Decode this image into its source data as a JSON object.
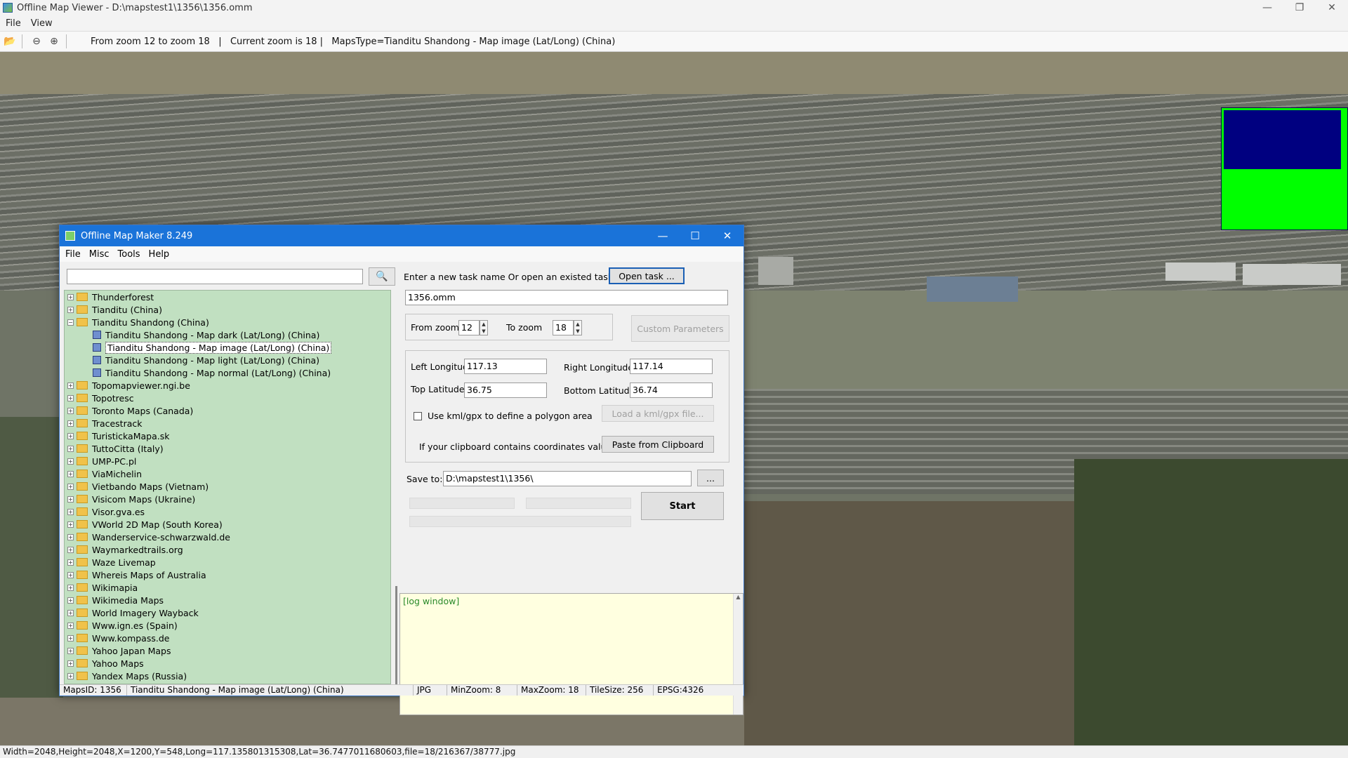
{
  "app": {
    "title": "Offline Map Viewer - D:\\mapstest1\\1356\\1356.omm",
    "menu": [
      "File",
      "View"
    ],
    "toolbar_info": "From zoom 12 to zoom 18   |   Current zoom is 18 |   MapsType=Tianditu Shandong - Map image (Lat/Long) (China)",
    "status": "Width=2048,Height=2048,X=1200,Y=548,Long=117.135801315308,Lat=36.7477011680603,file=18/216367/38777.jpg"
  },
  "dialog": {
    "title": "Offline Map Maker 8.249",
    "menu": [
      "File",
      "Misc",
      "Tools",
      "Help"
    ],
    "tree": [
      {
        "label": "Thunderforest",
        "type": "folder",
        "exp": "+"
      },
      {
        "label": "Tianditu (China)",
        "type": "folder",
        "exp": "+"
      },
      {
        "label": "Tianditu Shandong (China)",
        "type": "folder",
        "exp": "-"
      },
      {
        "label": "Tianditu Shandong - Map dark (Lat/Long) (China)",
        "type": "map"
      },
      {
        "label": "Tianditu Shandong - Map image (Lat/Long) (China)",
        "type": "map",
        "selected": true
      },
      {
        "label": "Tianditu Shandong - Map light (Lat/Long) (China)",
        "type": "map"
      },
      {
        "label": "Tianditu Shandong - Map normal (Lat/Long) (China)",
        "type": "map"
      },
      {
        "label": "Topomapviewer.ngi.be",
        "type": "folder",
        "exp": "+"
      },
      {
        "label": "Topotresc",
        "type": "folder",
        "exp": "+"
      },
      {
        "label": "Toronto Maps (Canada)",
        "type": "folder",
        "exp": "+"
      },
      {
        "label": "Tracestrack",
        "type": "folder",
        "exp": "+"
      },
      {
        "label": "TuristickaMapa.sk",
        "type": "folder",
        "exp": "+"
      },
      {
        "label": "TuttoCitta (Italy)",
        "type": "folder",
        "exp": "+"
      },
      {
        "label": "UMP-PC.pl",
        "type": "folder",
        "exp": "+"
      },
      {
        "label": "ViaMichelin",
        "type": "folder",
        "exp": "+"
      },
      {
        "label": "Vietbando Maps (Vietnam)",
        "type": "folder",
        "exp": "+"
      },
      {
        "label": "Visicom Maps (Ukraine)",
        "type": "folder",
        "exp": "+"
      },
      {
        "label": "Visor.gva.es",
        "type": "folder",
        "exp": "+"
      },
      {
        "label": "VWorld 2D Map (South Korea)",
        "type": "folder",
        "exp": "+"
      },
      {
        "label": "Wanderservice-schwarzwald.de",
        "type": "folder",
        "exp": "+"
      },
      {
        "label": "Waymarkedtrails.org",
        "type": "folder",
        "exp": "+"
      },
      {
        "label": "Waze Livemap",
        "type": "folder",
        "exp": "+"
      },
      {
        "label": "Whereis Maps of Australia",
        "type": "folder",
        "exp": "+"
      },
      {
        "label": "Wikimapia",
        "type": "folder",
        "exp": "+"
      },
      {
        "label": "Wikimedia Maps",
        "type": "folder",
        "exp": "+"
      },
      {
        "label": "World Imagery Wayback",
        "type": "folder",
        "exp": "+"
      },
      {
        "label": "Www.ign.es (Spain)",
        "type": "folder",
        "exp": "+"
      },
      {
        "label": "Www.kompass.de",
        "type": "folder",
        "exp": "+"
      },
      {
        "label": "Yahoo Japan Maps",
        "type": "folder",
        "exp": "+"
      },
      {
        "label": "Yahoo Maps",
        "type": "folder",
        "exp": "+"
      },
      {
        "label": "Yandex Maps (Russia)",
        "type": "folder",
        "exp": "+"
      }
    ],
    "task_prompt": "Enter a new task name Or open an existed task to continue:",
    "open_task": "Open task ...",
    "task_name": "1356.omm",
    "from_zoom_label": "From zoom",
    "from_zoom": "12",
    "to_zoom_label": "To zoom",
    "to_zoom": "18",
    "custom_params": "Custom Parameters",
    "left_lon_label": "Left Longitude",
    "left_lon": "117.13",
    "right_lon_label": "Right Longitude",
    "right_lon": "117.14",
    "top_lat_label": "Top Latitude",
    "top_lat": "36.75",
    "bottom_lat_label": "Bottom Latitude",
    "bottom_lat": "36.74",
    "kml_label": "Use kml/gpx to define a polygon area",
    "load_kml": "Load a kml/gpx file...",
    "clipboard_label": "If your clipboard contains coordinates values:",
    "paste_clip": "Paste from Clipboard",
    "save_label": "Save to:",
    "save_path": "D:\\mapstest1\\1356\\",
    "browse": "...",
    "start": "Start",
    "log": "[log window]",
    "status": [
      "MapsID: 1356",
      "Tianditu Shandong - Map image (Lat/Long) (China)",
      "JPG",
      "MinZoom: 8",
      "MaxZoom: 18",
      "TileSize: 256",
      "EPSG:4326"
    ]
  }
}
